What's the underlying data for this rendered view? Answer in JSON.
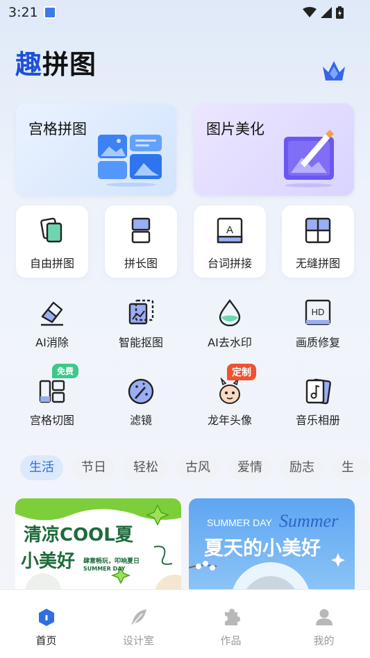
{
  "status": {
    "time": "3:21"
  },
  "app_title_first": "趣",
  "app_title_rest": "拼图",
  "cards": [
    {
      "label": "宫格拼图"
    },
    {
      "label": "图片美化"
    }
  ],
  "tools": [
    {
      "label": "自由拼图"
    },
    {
      "label": "拼长图"
    },
    {
      "label": "台词拼接",
      "icon_text": "A"
    },
    {
      "label": "无缝拼图"
    },
    {
      "label": "AI消除"
    },
    {
      "label": "智能抠图"
    },
    {
      "label": "AI去水印"
    },
    {
      "label": "画质修复",
      "icon_text": "HD"
    },
    {
      "label": "宫格切图",
      "badge": "免费"
    },
    {
      "label": "滤镜"
    },
    {
      "label": "龙年头像",
      "badge": "定制"
    },
    {
      "label": "音乐相册"
    }
  ],
  "tags": [
    "生活",
    "节日",
    "轻松",
    "古风",
    "爱情",
    "励志",
    "生日"
  ],
  "banners": [
    {
      "title_line1": "清凉COOL夏",
      "title_line2": "小美好",
      "sub_line1": "肆意畅玩，叩响夏日",
      "sub_line2": "SUMMER DAY"
    },
    {
      "en_title": "SUMMER DAY",
      "script": "Summer",
      "title": "夏天的小美好"
    }
  ],
  "tabs": [
    {
      "label": "首页"
    },
    {
      "label": "设计室"
    },
    {
      "label": "作品"
    },
    {
      "label": "我的"
    }
  ],
  "colors": {
    "accent": "#2f6fe0",
    "brand": "#1d4fd8",
    "badge_green": "#3cc88a",
    "badge_red": "#f2512f"
  }
}
